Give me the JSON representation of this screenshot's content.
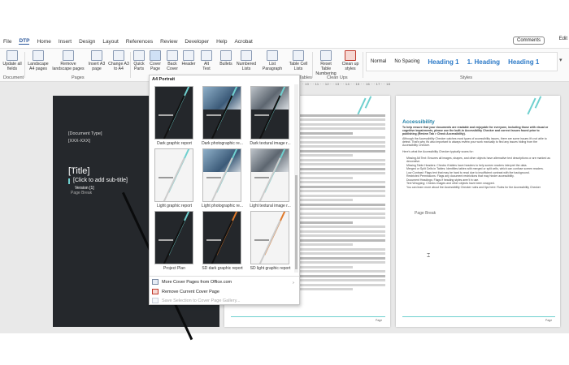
{
  "menu": {
    "tabs": [
      "File",
      "DTP",
      "Home",
      "Insert",
      "Design",
      "Layout",
      "References",
      "Review",
      "Developer",
      "Help",
      "Acrobat"
    ],
    "active_tab": "DTP",
    "comments_label": "Comments",
    "edit_label": "Edit"
  },
  "ribbon": {
    "buttons": [
      {
        "label": "Update all fields",
        "icon": "update-fields-icon"
      },
      {
        "label": "Landscape A4 pages",
        "icon": "landscape-icon"
      },
      {
        "label": "Remove landscape pages",
        "icon": "remove-landscape-icon"
      },
      {
        "label": "Insert A3 page",
        "icon": "insert-a3-icon"
      },
      {
        "label": "Change A3 to A4",
        "icon": "change-a3-icon"
      },
      {
        "label": "Quick Parts",
        "icon": "quick-parts-icon"
      },
      {
        "label": "Cover Page",
        "icon": "cover-page-icon"
      },
      {
        "label": "Back Cover",
        "icon": "back-cover-icon"
      },
      {
        "label": "Header",
        "icon": "header-icon"
      },
      {
        "label": "Alt Text",
        "icon": "alt-text-icon"
      },
      {
        "label": "Bullets",
        "icon": "bullets-icon"
      },
      {
        "label": "Numbered Lists",
        "icon": "numbered-lists-icon"
      },
      {
        "label": "List Paragraph",
        "icon": "list-paragraph-icon"
      },
      {
        "label": "Table Cell Lists",
        "icon": "table-cell-icon"
      },
      {
        "label": "Reset Table Numbering",
        "icon": "reset-table-icon"
      },
      {
        "label": "Clean up styles",
        "icon": "clean-up-icon"
      }
    ],
    "groups": {
      "document": "Document",
      "pages": "Pages",
      "tables": "Tables",
      "clean_ups": "Clean Ups",
      "styles": "Styles"
    },
    "styles": [
      "Normal",
      "No Spacing",
      "Heading 1",
      "1. Heading",
      "Heading 1"
    ]
  },
  "ruler_text": "· 10 · · 11 · · 12 · · 13 · · 14 · · 15 · · 16 · · 17 · · 18 ·",
  "gallery": {
    "header": "A4 Portrait",
    "items": [
      {
        "label": "Dark graphic report",
        "style": "dark"
      },
      {
        "label": "Dark photographic re...",
        "style": "dark-photo"
      },
      {
        "label": "Dark textural image r...",
        "style": "dark-texture"
      },
      {
        "label": "Light graphic report",
        "style": "light"
      },
      {
        "label": "Light photographic re...",
        "style": "light-photo"
      },
      {
        "label": "Light textural image r...",
        "style": "light-texture"
      },
      {
        "label": "Project Plan",
        "style": "dark"
      },
      {
        "label": "SD dark graphic report",
        "style": "dark-orange"
      },
      {
        "label": "SD light graphic report",
        "style": "light-orange"
      }
    ],
    "menu": {
      "more": "More Cover Pages from Office.com",
      "remove": "Remove Current Cover Page",
      "save": "Save Selection to Cover Page Gallery..."
    }
  },
  "cover": {
    "doc_type": "[Document Type]",
    "date": "[XXX-XXX]",
    "title": "[Title]",
    "subtitle": "[Click to add sub-title]",
    "version": "Version [1]",
    "page_break": "Page Break"
  },
  "page3": {
    "heading": "Accessibility",
    "intro": "To help ensure that your documents are readable and enjoyable for everyone, including those with visual or cognitive impairments, please use the built-in Accessibility Checker and correct issues found prior to publishing (Review Tab > Check Accessibility).",
    "p1": "Although the Accessibility Checker catches most types of accessibility issues, there are some issues it's not able to detect. That's why it's also important to always review your work manually to find any issues hiding from the Accessibility Checker.",
    "p2": "Here's what the Accessibility Checker typically scans for:",
    "bullets": [
      "Missing Alt Text: Ensures all images, shapes, and other objects have alternative text descriptions or are marked as decorative.",
      "Missing Table Headers: Checks if tables have headers to help screen readers interpret the data.",
      "Merged or Split Cells in Tables: Identifies tables with merged or split cells, which can confuse screen readers.",
      "Low Contrast: Flags text that may be hard to read due to insufficient contrast with the background.",
      "Restricted Permissions: Flags any document restrictions that may hinder accessibility.",
      "Document Headings: Flags if heading styles aren't in use.",
      "Text Wrapping: Checks images and other objects have been wrapped.",
      "You can learn more about the Accessibility Checker rules and tips here: Rules for the Accessibility Checker"
    ],
    "page_break": "Page Break"
  },
  "footer": {
    "page_label": "Page"
  },
  "colors": {
    "accent": "#2b579a",
    "teal": "#6fd0cf",
    "cover_bg": "#25282c",
    "heading": "#1f7fa6"
  }
}
